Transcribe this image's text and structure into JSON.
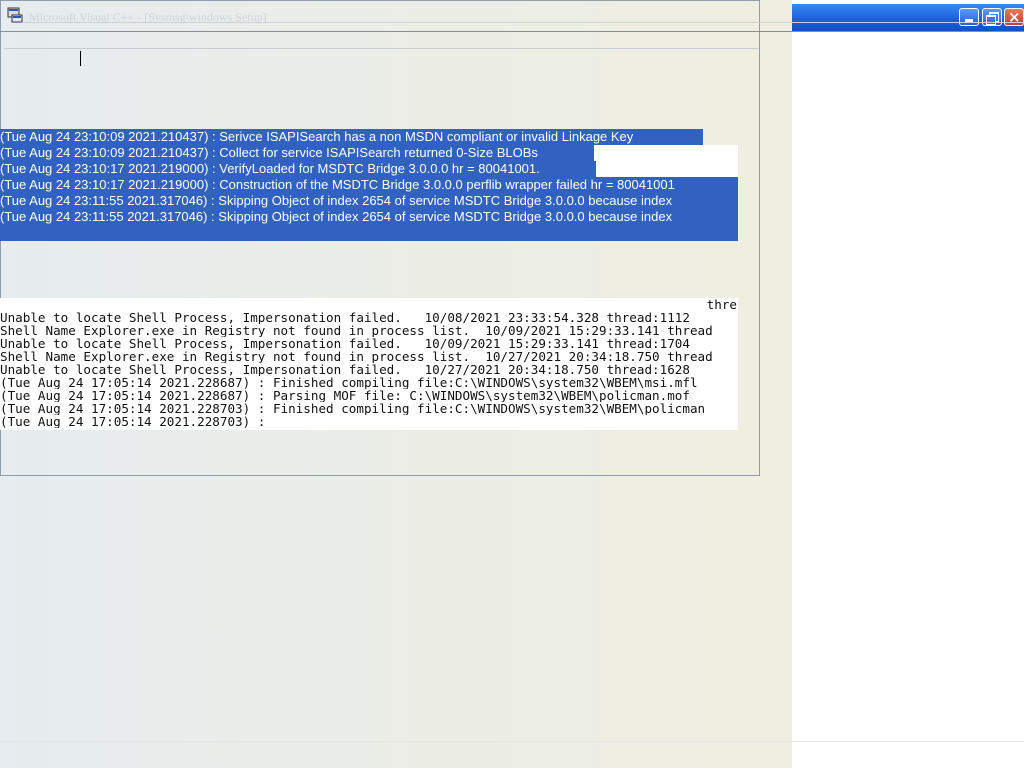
{
  "window": {
    "title": "Microsoft Visual C++ - [Sysmsg\\windows Setup]"
  },
  "highlighted_log": [
    "(Tue Aug 24 23:10:09 2021.210437) : Serivce ISAPISearch has a non MSDN compliant or invalid Linkage Key",
    "(Tue Aug 24 23:10:09 2021.210437) : Collect for service ISAPISearch returned 0-Size BLOBs",
    "(Tue Aug 24 23:10:17 2021.219000) : VerifyLoaded for MSDTC Bridge 3.0.0.0 hr = 80041001.",
    "(Tue Aug 24 23:10:17 2021.219000) : Construction of the MSDTC Bridge 3.0.0.0 perflib wrapper failed hr = 80041001",
    "(Tue Aug 24 23:11:55 2021.317046) : Skipping Object of index 2654 of service MSDTC Bridge 3.0.0.0  because index",
    "(Tue Aug 24 23:11:55 2021.317046) : Skipping Object of index 2654 of service MSDTC Bridge 3.0.0.0  because index"
  ],
  "plain_log_header": "thre",
  "plain_log": [
    "Unable to locate Shell Process, Impersonation failed.   10/08/2021 23:33:54.328 thread:1112",
    "Shell Name Explorer.exe in Registry not found in process list.  10/09/2021 15:29:33.141 thread",
    "Unable to locate Shell Process, Impersonation failed.   10/09/2021 15:29:33.141 thread:1704",
    "Shell Name Explorer.exe in Registry not found in process list.  10/27/2021 20:34:18.750 thread",
    "Unable to locate Shell Process, Impersonation failed.   10/27/2021 20:34:18.750 thread:1628",
    "(Tue Aug 24 17:05:14 2021.228687) : Finished compiling file:C:\\WINDOWS\\system32\\WBEM\\msi.mfl",
    "(Tue Aug 24 17:05:14 2021.228687) : Parsing MOF file: C:\\WINDOWS\\system32\\WBEM\\policman.mof",
    "(Tue Aug 24 17:05:14 2021.228703) : Finished compiling file:C:\\WINDOWS\\system32\\WBEM\\policman",
    "(Tue Aug 24 17:05:14 2021.228703) :"
  ],
  "colors": {
    "selection": "#3162bf",
    "titlebar": "#1c62e0"
  },
  "icons": {
    "app": "app-window-icon",
    "minimize": "minimize-icon",
    "restore": "restore-icon",
    "close": "close-icon"
  }
}
